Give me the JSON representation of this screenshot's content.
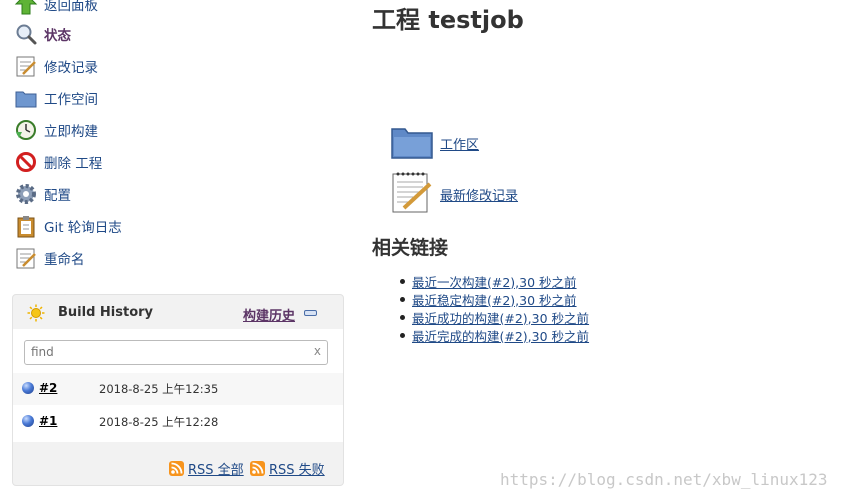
{
  "sidebar": {
    "tasks": [
      {
        "label": "返回面板",
        "icon": "up-arrow-icon"
      },
      {
        "label": "状态",
        "icon": "magnifier-icon"
      },
      {
        "label": "修改记录",
        "icon": "notepad-icon"
      },
      {
        "label": "工作空间",
        "icon": "folder-icon"
      },
      {
        "label": "立即构建",
        "icon": "clock-build-icon"
      },
      {
        "label": "删除 工程",
        "icon": "no-entry-icon"
      },
      {
        "label": "配置",
        "icon": "gear-icon"
      },
      {
        "label": "Git 轮询日志",
        "icon": "clipboard-icon"
      },
      {
        "label": "重命名",
        "icon": "notepad-icon"
      }
    ]
  },
  "build_history": {
    "title": "Build History",
    "trend_link": "构建历史",
    "find_placeholder": "find",
    "clear": "x",
    "builds": [
      {
        "number": "#2",
        "date": "2018-8-25 上午12:35"
      },
      {
        "number": "#1",
        "date": "2018-8-25 上午12:28"
      }
    ],
    "rss_all": "RSS 全部",
    "rss_failed": "RSS 失败"
  },
  "main": {
    "title": "工程 testjob",
    "workspace_link": "工作区",
    "changes_link": "最新修改记录",
    "related_title": "相关链接",
    "links": [
      "最近一次构建(#2),30 秒之前",
      "最近稳定构建(#2),30 秒之前",
      "最近成功的构建(#2),30 秒之前",
      "最近完成的构建(#2),30 秒之前"
    ]
  },
  "watermark": "https://blog.csdn.net/xbw_linux123"
}
